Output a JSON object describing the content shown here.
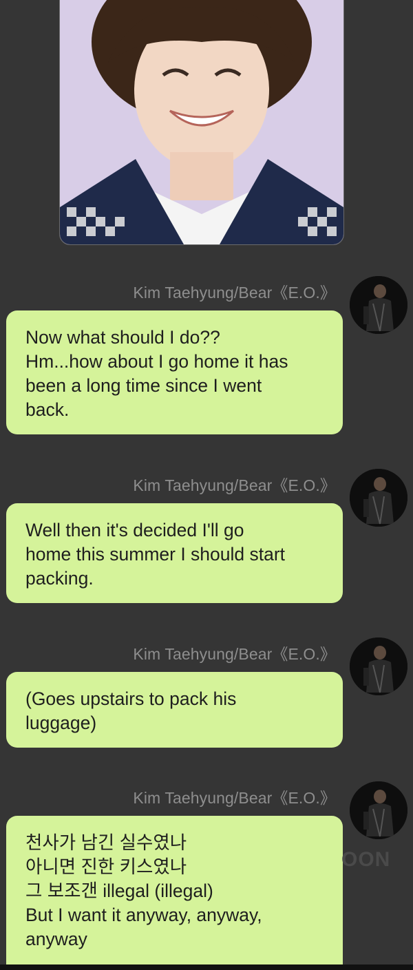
{
  "photo": {
    "description_icon": "portrait-photo"
  },
  "messages": [
    {
      "sender": "Kim Taehyung/Bear《E.O.》",
      "lines": [
        "Now what should I do??",
        "Hm...how about I go home it has",
        "been a long time since I went",
        "back."
      ]
    },
    {
      "sender": "Kim Taehyung/Bear《E.O.》",
      "lines": [
        "Well then it's decided I'll go",
        "home this summer I should start",
        "packing."
      ]
    },
    {
      "sender": "Kim Taehyung/Bear《E.O.》",
      "lines": [
        "(Goes upstairs to pack his",
        "luggage)"
      ]
    },
    {
      "sender": "Kim Taehyung/Bear《E.O.》",
      "lines": [
        "천사가 남긴 실수였나",
        "아니면 진한 키스였나",
        "그 보조갠 illegal (illegal)",
        "But I want it anyway, anyway,",
        "anyway"
      ]
    }
  ],
  "watermark": "OON",
  "colors": {
    "background": "#353535",
    "bubble": "#d5f39a",
    "sender_text": "#8e8e8e"
  }
}
